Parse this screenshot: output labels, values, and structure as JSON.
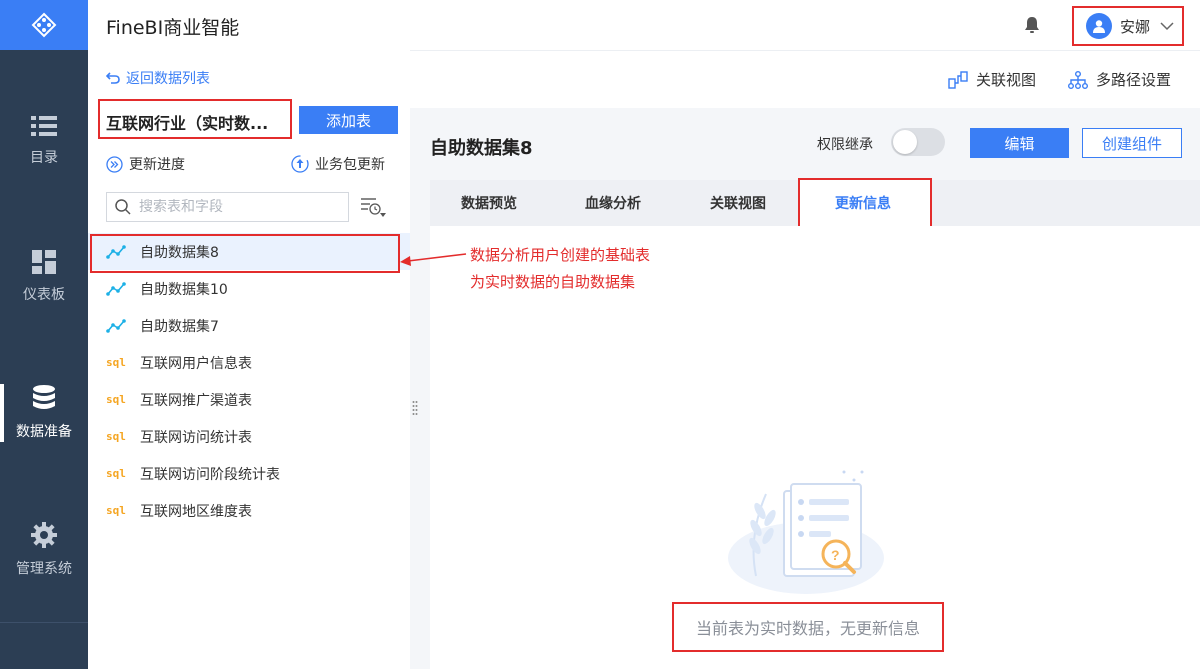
{
  "app": {
    "title": "FineBI商业智能"
  },
  "user": {
    "name": "安娜"
  },
  "nav": {
    "items": [
      {
        "label": "目录",
        "icon": "list-icon"
      },
      {
        "label": "仪表板",
        "icon": "dashboard-icon"
      },
      {
        "label": "数据准备",
        "icon": "database-icon",
        "active": true
      },
      {
        "label": "管理系统",
        "icon": "gear-icon"
      }
    ]
  },
  "panel": {
    "back_label": "返回数据列表",
    "package_name": "互联网行业（实时数...",
    "add_table_label": "添加表",
    "update_progress_label": "更新进度",
    "package_update_label": "业务包更新",
    "search_placeholder": "搜索表和字段",
    "tables": [
      {
        "label": "自助数据集8",
        "type": "self-service",
        "selected": true
      },
      {
        "label": "自助数据集10",
        "type": "self-service"
      },
      {
        "label": "自助数据集7",
        "type": "self-service"
      },
      {
        "label": "互联网用户信息表",
        "type": "sql"
      },
      {
        "label": "互联网推广渠道表",
        "type": "sql"
      },
      {
        "label": "互联网访问统计表",
        "type": "sql"
      },
      {
        "label": "互联网访问阶段统计表",
        "type": "sql"
      },
      {
        "label": "互联网地区维度表",
        "type": "sql"
      }
    ],
    "sql_tag": "sql"
  },
  "toolbar": {
    "assoc_view_label": "关联视图",
    "multipath_label": "多路径设置"
  },
  "main": {
    "dataset_title": "自助数据集8",
    "permission_label": "权限继承",
    "permission_on": false,
    "edit_label": "编辑",
    "create_component_label": "创建组件",
    "tabs": [
      {
        "label": "数据预览"
      },
      {
        "label": "血缘分析"
      },
      {
        "label": "关联视图"
      },
      {
        "label": "更新信息",
        "active": true
      }
    ],
    "empty_message": "当前表为实时数据，无更新信息"
  },
  "annotation": {
    "line1": "数据分析用户创建的基础表",
    "line2": "为实时数据的自助数据集"
  },
  "colors": {
    "accent": "#3a7ef5",
    "nav_bg": "#2c3e54",
    "highlight": "#e32c2c",
    "sql": "#f5a623"
  }
}
